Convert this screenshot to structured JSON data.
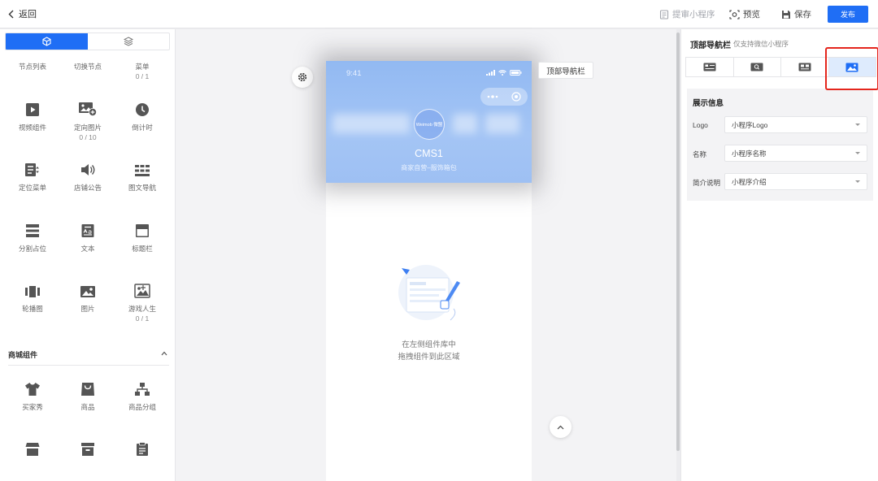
{
  "header": {
    "back_label": "返回",
    "review_label": "提审小程序",
    "preview_label": "预览",
    "save_label": "保存",
    "publish_label": "发布"
  },
  "left": {
    "tabs": [
      {
        "icon": "cube-icon",
        "active": true
      },
      {
        "icon": "layers-icon",
        "active": false
      }
    ],
    "components": [
      {
        "label": "节点列表",
        "count": "",
        "icon": ""
      },
      {
        "label": "切换节点",
        "count": "",
        "icon": ""
      },
      {
        "label": "菜单",
        "count": "0 / 1",
        "icon": ""
      },
      {
        "label": "视频组件",
        "count": "",
        "icon": "video-icon"
      },
      {
        "label": "定向图片",
        "count": "0 / 10",
        "icon": "image-plus-icon"
      },
      {
        "label": "倒计时",
        "count": "",
        "icon": "clock-icon"
      },
      {
        "label": "定位菜单",
        "count": "",
        "icon": "locate-menu-icon"
      },
      {
        "label": "店铺公告",
        "count": "",
        "icon": "speaker-icon"
      },
      {
        "label": "图文导航",
        "count": "",
        "icon": "grid-nav-icon"
      },
      {
        "label": "分割占位",
        "count": "",
        "icon": "divider-icon"
      },
      {
        "label": "文本",
        "count": "",
        "icon": "text-icon"
      },
      {
        "label": "标题栏",
        "count": "",
        "icon": "title-bar-icon"
      },
      {
        "label": "轮播图",
        "count": "",
        "icon": "carousel-icon"
      },
      {
        "label": "图片",
        "count": "",
        "icon": "picture-icon"
      },
      {
        "label": "游戏人生",
        "count": "0 / 1",
        "icon": "game-image-icon"
      }
    ],
    "mall_section": {
      "title": "商城组件",
      "items": [
        {
          "label": "买家秀",
          "icon": "tshirt-icon"
        },
        {
          "label": "商品",
          "icon": "shopping-bag-icon"
        },
        {
          "label": "商品分组",
          "icon": "org-tree-icon"
        },
        {
          "label": "",
          "icon": "store-icon"
        },
        {
          "label": "",
          "icon": "archive-icon"
        },
        {
          "label": "",
          "icon": "clipboard-icon"
        }
      ]
    }
  },
  "phone": {
    "time": "9:41",
    "logo_text": "Weimob 微盟",
    "title": "CMS1",
    "subtitle": "商家自营–服饰箱包",
    "nav_tooltip": "顶部导航栏",
    "empty_line1": "在左侧组件库中",
    "empty_line2": "拖拽组件到此区域"
  },
  "right": {
    "title": "顶部导航栏",
    "note": "仅支持微信小程序",
    "style_tabs": [
      {
        "icon": "style-text-icon",
        "active": false
      },
      {
        "icon": "style-search-icon",
        "active": false
      },
      {
        "icon": "style-card-icon",
        "active": false
      },
      {
        "icon": "style-image-icon",
        "active": true
      }
    ],
    "section_title": "展示信息",
    "fields": [
      {
        "label": "Logo",
        "value": "小程序Logo"
      },
      {
        "label": "名称",
        "value": "小程序名称"
      },
      {
        "label": "简介说明",
        "value": "小程序介绍"
      }
    ]
  },
  "colors": {
    "primary": "#1f6ef5",
    "highlight": "#e4261d",
    "header_blue": "#9ec0f3"
  }
}
